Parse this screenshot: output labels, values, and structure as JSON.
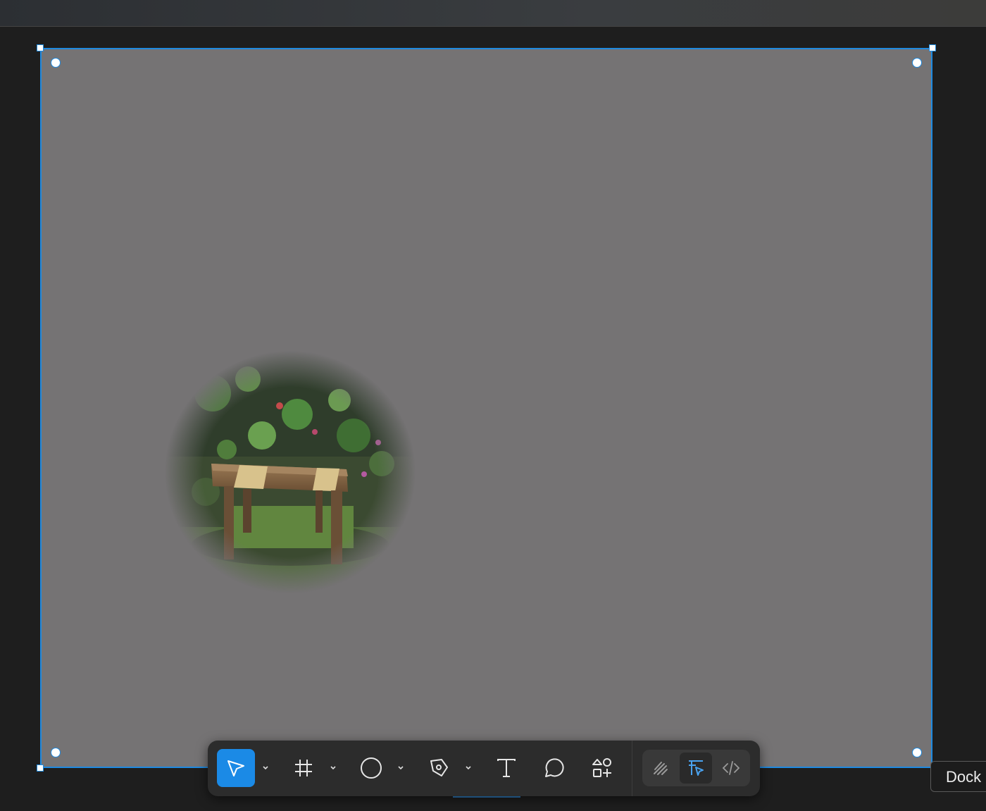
{
  "colors": {
    "accent": "#1b8ae6",
    "selection": "#1f8ae0",
    "frame_fill": "#757374",
    "canvas_bg": "#1e1e1e",
    "toolbar_bg": "#2c2c2c"
  },
  "canvas": {
    "frame_image": "garden-bench-photo"
  },
  "toolbar": {
    "tools": [
      {
        "name": "move-tool",
        "icon": "pointer-arrow-icon",
        "active": true,
        "has_menu": true
      },
      {
        "name": "frame-tool",
        "icon": "frame-hash-icon",
        "active": false,
        "has_menu": true
      },
      {
        "name": "shape-tool",
        "icon": "ellipse-icon",
        "active": false,
        "has_menu": true
      },
      {
        "name": "pen-tool",
        "icon": "pen-nib-icon",
        "active": false,
        "has_menu": true
      },
      {
        "name": "text-tool",
        "icon": "text-t-icon",
        "active": false,
        "has_menu": false
      },
      {
        "name": "comment-tool",
        "icon": "comment-bubble-icon",
        "active": false,
        "has_menu": false
      },
      {
        "name": "resources-tool",
        "icon": "shapes-plus-icon",
        "active": false,
        "has_menu": false
      }
    ],
    "modes": [
      {
        "name": "draw-mode",
        "icon": "scribble-icon",
        "active": false
      },
      {
        "name": "design-mode",
        "icon": "design-cursor-icon",
        "active": true
      },
      {
        "name": "dev-mode",
        "icon": "code-brackets-icon",
        "active": false
      }
    ]
  },
  "tooltip": {
    "text": "Dock"
  }
}
